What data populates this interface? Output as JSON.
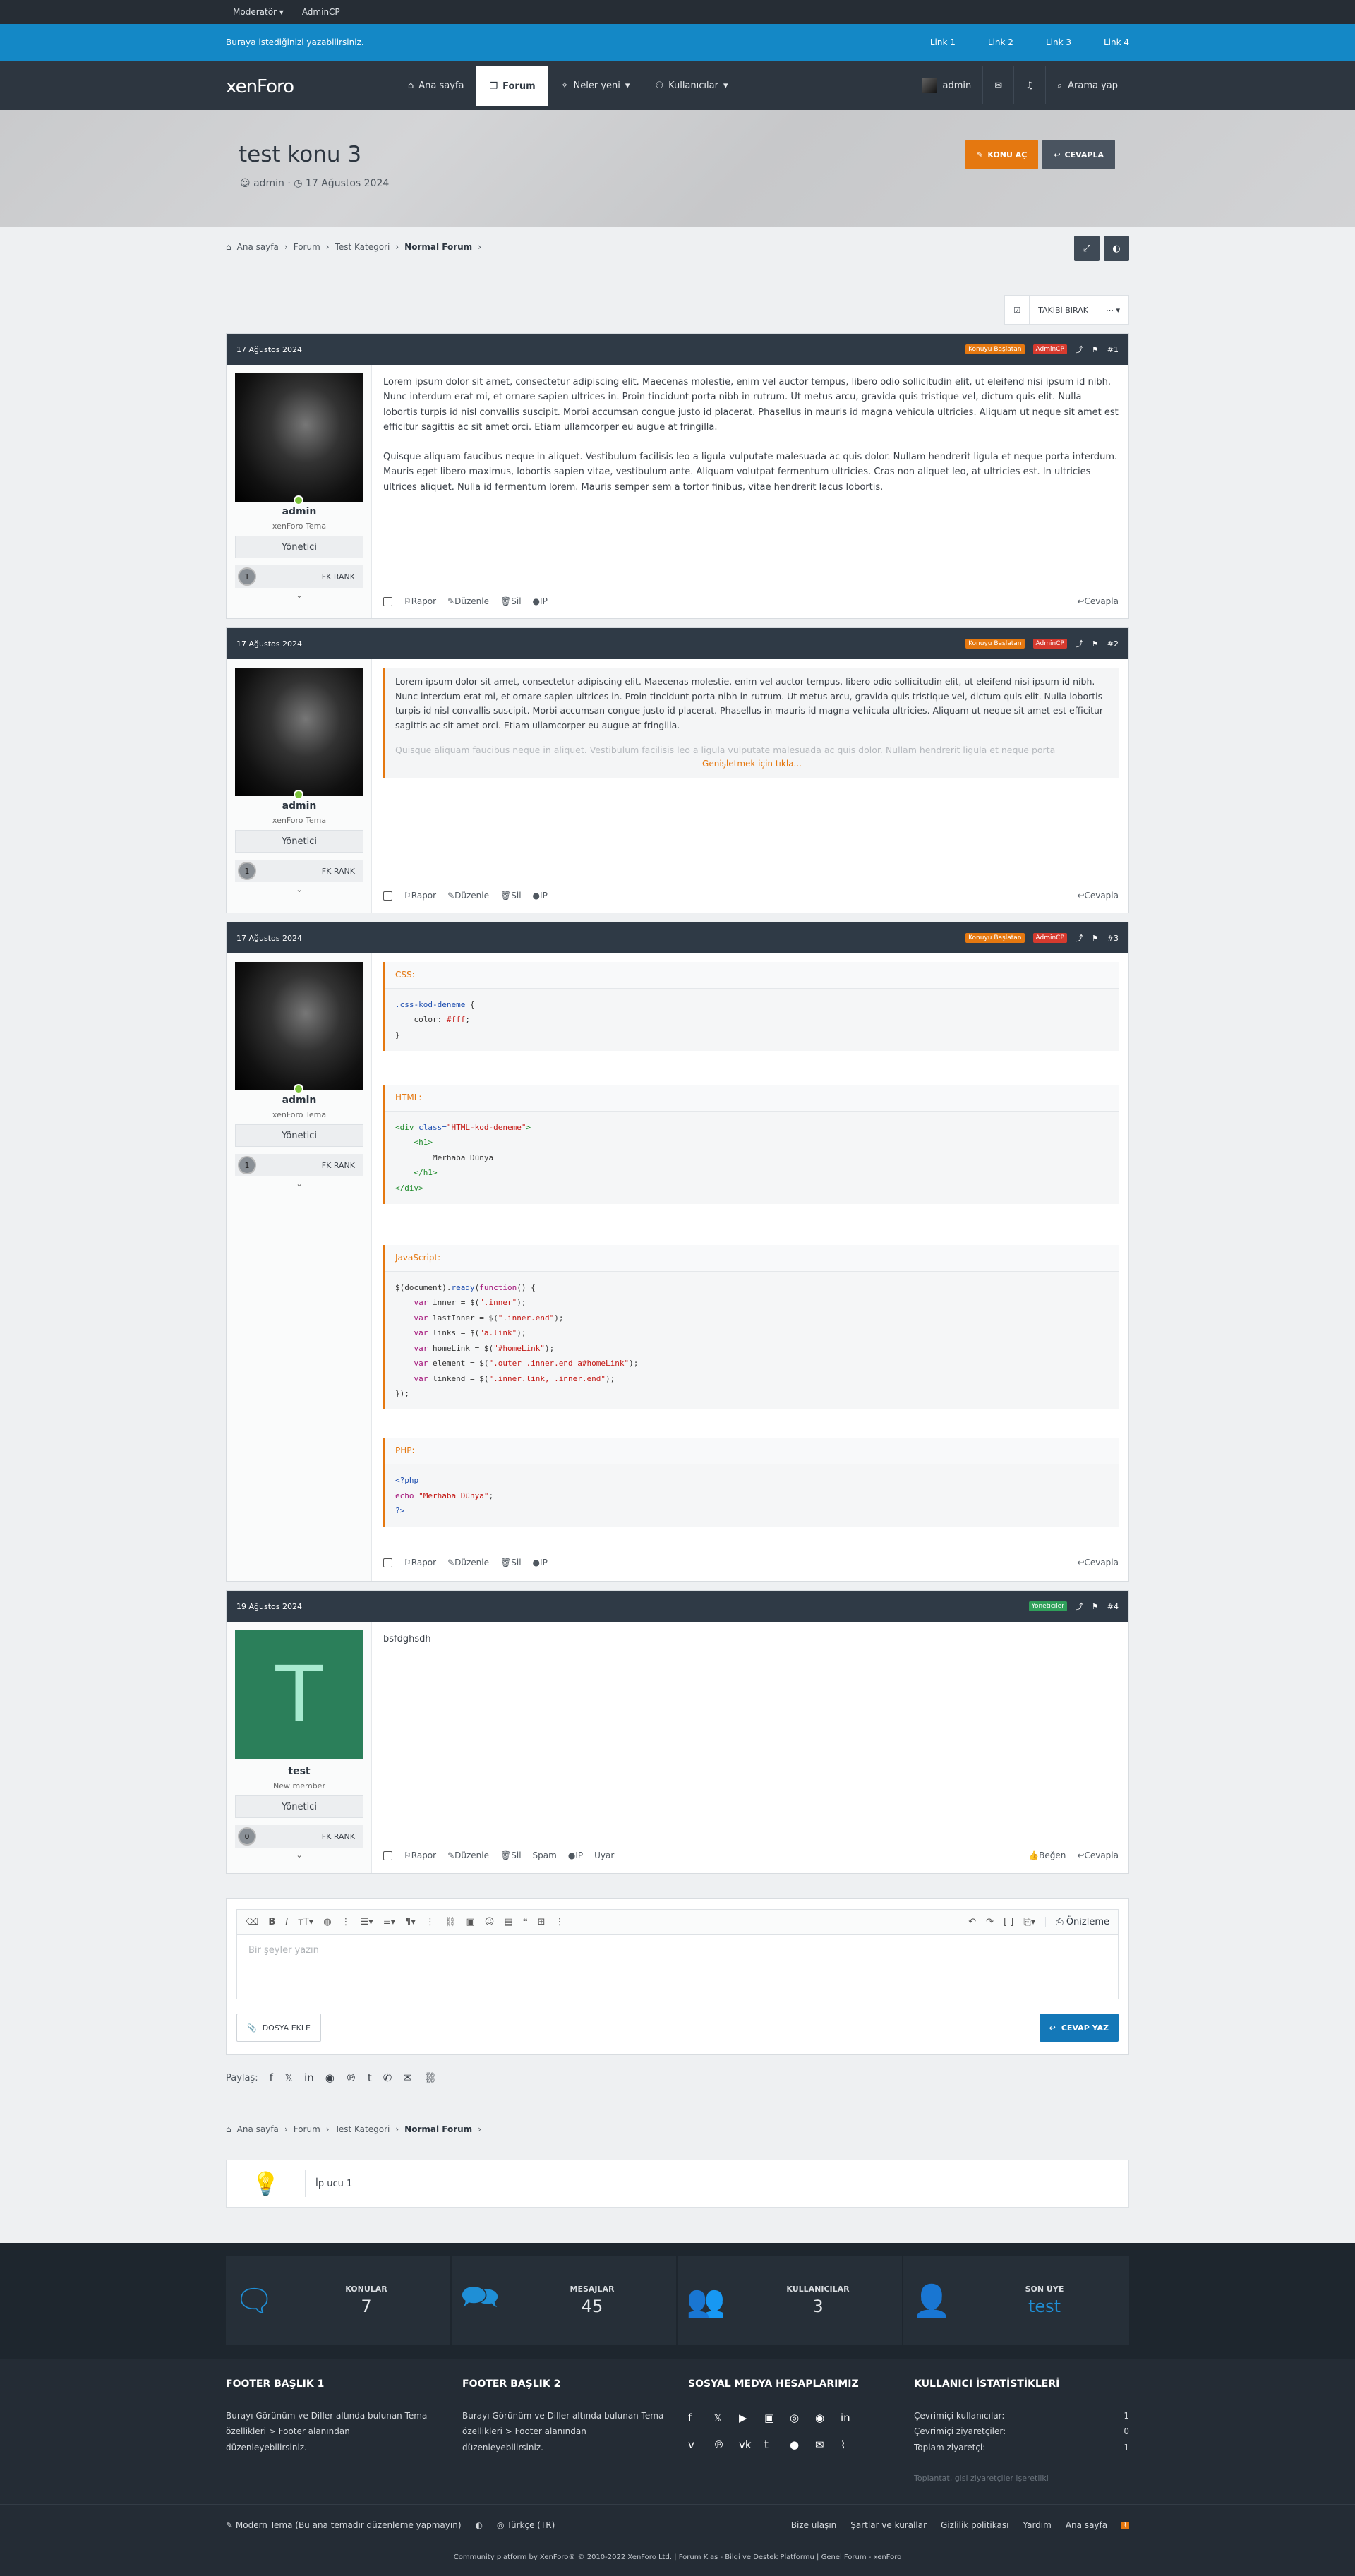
{
  "topbar": {
    "items": [
      "Moderatör ▾",
      "AdminCP"
    ]
  },
  "notice": {
    "text": "Buraya istediğinizi yazabilirsiniz.",
    "links": [
      "Link 1",
      "Link 2",
      "Link 3",
      "Link 4"
    ]
  },
  "nav": {
    "logo": "xenForo",
    "tabs": [
      "Ana sayfa",
      "Forum",
      "Neler yeni",
      "Kullanıcılar"
    ],
    "user": "admin",
    "search": "Arama yap"
  },
  "thread": {
    "title": "test konu 3",
    "author": "admin",
    "date": "17 Ağustos 2024",
    "btn_new": "KONU AÇ",
    "btn_reply": "CEVAPLA"
  },
  "breadcrumb": [
    "Ana sayfa",
    "Forum",
    "Test Kategori",
    "Normal Forum"
  ],
  "toolbar": {
    "unwatch": "TAKİBİ BIRAK",
    "more": "⋯ ▾"
  },
  "posts": [
    {
      "date": "17 Ağustos 2024",
      "badges": [
        "Konuyu Başlatan",
        "AdminCP"
      ],
      "num": "#1",
      "user": "admin",
      "utitle": "xenForo Tema",
      "role": "Yönetici",
      "rank": "FK RANK",
      "rank_num": "1",
      "p1": "Lorem ipsum dolor sit amet, consectetur adipiscing elit. Maecenas molestie, enim vel auctor tempus, libero odio sollicitudin elit, ut eleifend nisi ipsum id nibh. Nunc interdum erat mi, et ornare sapien ultrices in. Proin tincidunt porta nibh in rutrum. Ut metus arcu, gravida quis tristique vel, dictum quis elit. Nulla lobortis turpis id nisl convallis suscipit. Morbi accumsan congue justo id placerat. Phasellus in mauris id magna vehicula ultricies. Aliquam ut neque sit amet est efficitur sagittis ac sit amet orci. Etiam ullamcorper eu augue at fringilla.",
      "p2": "Quisque aliquam faucibus neque in aliquet. Vestibulum facilisis leo a ligula vulputate malesuada ac quis dolor. Nullam hendrerit ligula et neque porta interdum. Mauris eget libero maximus, lobortis sapien vitae, vestibulum ante. Aliquam volutpat fermentum ultricies. Cras non aliquet leo, at ultricies est. In ultricies ultrices aliquet. Nulla id fermentum lorem. Mauris semper sem a tortor finibus, vitae hendrerit lacus lobortis."
    },
    {
      "date": "17 Ağustos 2024",
      "badges": [
        "Konuyu Başlatan",
        "AdminCP"
      ],
      "num": "#2",
      "user": "admin",
      "utitle": "xenForo Tema",
      "role": "Yönetici",
      "rank": "FK RANK",
      "rank_num": "1",
      "quote": "Lorem ipsum dolor sit amet, consectetur adipiscing elit. Maecenas molestie, enim vel auctor tempus, libero odio sollicitudin elit, ut eleifend nisi ipsum id nibh. Nunc interdum erat mi, et ornare sapien ultrices in. Proin tincidunt porta nibh in rutrum. Ut metus arcu, gravida quis tristique vel, dictum quis elit. Nulla lobortis turpis id nisl convallis suscipit. Morbi accumsan congue justo id placerat. Phasellus in mauris id magna vehicula ultricies. Aliquam ut neque sit amet est efficitur sagittis ac sit amet orci. Etiam ullamcorper eu augue at fringilla.",
      "fade": "Quisque aliquam faucibus neque in aliquet. Vestibulum facilisis leo a ligula vulputate malesuada ac quis dolor. Nullam hendrerit ligula et neque porta",
      "expand": "Genişletmek için tıkla..."
    },
    {
      "date": "17 Ağustos 2024",
      "badges": [
        "Konuyu Başlatan",
        "AdminCP"
      ],
      "num": "#3",
      "user": "admin",
      "utitle": "xenForo Tema",
      "role": "Yönetici",
      "rank": "FK RANK",
      "rank_num": "1",
      "code_titles": [
        "CSS:",
        "HTML:",
        "JavaScript:",
        "PHP:"
      ]
    },
    {
      "date": "19 Ağustos 2024",
      "badges": [
        "Yöneticiler"
      ],
      "num": "#4",
      "user": "test",
      "utitle": "New member",
      "role": "Yönetici",
      "rank": "FK RANK",
      "rank_num": "0",
      "initial": "T",
      "text": "bsfdghsdh"
    }
  ],
  "actions": {
    "report": "Rapor",
    "edit": "Düzenle",
    "delete": "Sil",
    "ip": "IP",
    "spam": "Spam",
    "warn": "Uyar",
    "like": "Beğen",
    "reply": "Cevapla"
  },
  "editor": {
    "placeholder": "Bir şeyler yazın",
    "preview": "Önizleme",
    "attach": "DOSYA EKLE",
    "submit": "CEVAP YAZ"
  },
  "share": {
    "label": "Paylaş:"
  },
  "tip": {
    "text": "İp ucu 1"
  },
  "stats": [
    {
      "label": "KONULAR",
      "value": "7"
    },
    {
      "label": "MESAJLAR",
      "value": "45"
    },
    {
      "label": "KULLANICILAR",
      "value": "3"
    },
    {
      "label": "SON ÜYE",
      "value": "test"
    }
  ],
  "footer": {
    "h1": "FOOTER BAŞLIK 1",
    "t1": "Burayı Görünüm ve Diller altında bulunan Tema özellikleri > Footer alanından düzenleyebilirsiniz.",
    "h2": "FOOTER BAŞLIK 2",
    "t2": "Burayı Görünüm ve Diller altında bulunan Tema özellikleri > Footer alanından düzenleyebilirsiniz.",
    "h3": "SOSYAL MEDYA HESAPLARIMIZ",
    "h4": "KULLANICI İSTATİSTİKLERİ",
    "online_users": "Çevrimiçi kullanıcılar:",
    "online_users_v": "1",
    "online_guests": "Çevrimiçi ziyaretçiler:",
    "online_guests_v": "0",
    "total": "Toplam ziyaretçi:",
    "total_v": "1",
    "muted": "Toplantat, gisi ziyaretçiler işeretlikl",
    "style": "Modern Tema (Bu ana temadır düzenleme yapmayın)",
    "lang": "Türkçe (TR)",
    "links": [
      "Bize ulaşın",
      "Şartlar ve kurallar",
      "Gizlilik politikası",
      "Yardım",
      "Ana sayfa"
    ],
    "copyright": "Community platform by XenForo® © 2010-2022 XenForo Ltd. | Forum Klas - Bilgi ve Destek Platformu | Genel Forum - xenForo"
  }
}
